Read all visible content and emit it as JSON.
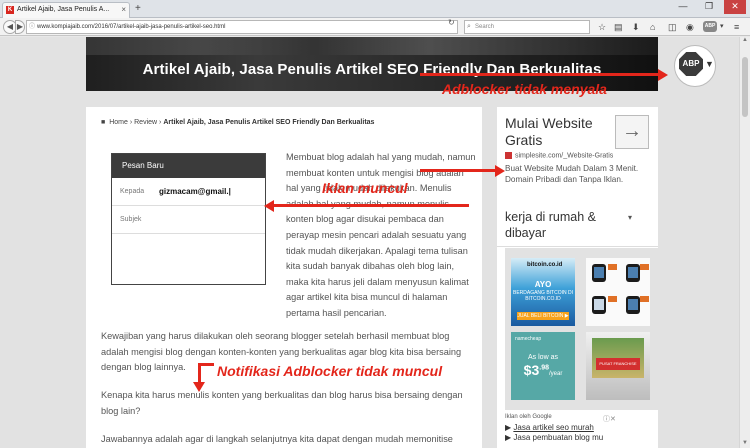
{
  "browser": {
    "tab_title": "Artikel Ajaib, Jasa Penulis A...",
    "tab_close": "×",
    "new_tab": "+",
    "back": "◀",
    "forward": "▶",
    "url": "www.kompiajaib.com/2016/07/artikel-ajaib-jasa-penulis-artikel-seo.html",
    "reload": "↻",
    "search_placeholder": "Search",
    "abp_small_label": "ABP",
    "window_min": "—",
    "window_max": "❐",
    "window_close": "✕"
  },
  "banner": {
    "title": "Artikel Ajaib, Jasa Penulis Artikel SEO Friendly Dan Berkualitas"
  },
  "abp_badge": {
    "label": "ABP"
  },
  "breadcrumb": {
    "home": "Home",
    "sep1": "›",
    "review": "Review",
    "sep2": "›",
    "current": "Artikel Ajaib, Jasa Penulis Artikel SEO Friendly Dan Berkualitas"
  },
  "form": {
    "header": "Pesan Baru",
    "to_label": "Kepada",
    "to_value": "gizmacam@gmail.|",
    "subject_label": "Subjek"
  },
  "article": {
    "para_side": "Membuat blog adalah hal yang mudah, namun membuat konten untuk mengisi blog adalah hal yang tidak mudah dilakukan. Menulis adalah hal yang mudah, namun menulis konten blog agar disukai pembaca dan perayap mesin pencari adalah sesuatu yang tidak mudah dikerjakan. Apalagi tema tulisan kita sudah banyak dibahas oleh blog lain, maka kita harus jeli dalam menyusun kalimat agar artikel kita bisa muncul di halaman pertama hasil pencarian.",
    "para2": "Kewajiban yang harus dilakukan oleh seorang blogger setelah berhasil membuat blog adalah mengisi blog dengan konten-konten yang berkualitas agar blog kita bisa bersaing dengan blog lainnya.",
    "para3": "Kenapa kita harus menulis konten yang berkualitas dan blog harus bisa bersaing dengan blog lain?",
    "para4": "Jawabannya adalah agar di langkah selanjutnya kita dapat dengan mudah memonitise"
  },
  "sidebar": {
    "ad_title": "Mulai Website Gratis",
    "ad_arrow": "→",
    "ad_url": "simplesite.com/_Website-Gratis",
    "ad_desc": "Buat Website Mudah Dalam 3 Menit. Domain Pribadi dan Tanpa Iklan.",
    "ad2_title": "kerja di rumah & dibayar",
    "ad2_caret": "▾",
    "bitcoin": {
      "logo": "bitcoin.co.id",
      "headline": "AYO",
      "text": "BERDAGANG BITCOIN DI BITCOIN.CO.ID",
      "button": "JUAL BELI BITCOIN ▶"
    },
    "namecheap": {
      "brand": "namecheap",
      "as_low_as": "As low as",
      "price_main": "$3",
      "price_cents": ".98",
      "price_unit": "/year"
    },
    "shop_sign": "PUSAT FRANCHISE",
    "ads_label": "Iklan oleh Google",
    "ads_info": "ⓘ✕",
    "links": [
      "Jasa artikel seo murah",
      "Jasa pembuatan blog mu"
    ]
  },
  "annotations": {
    "adblocker_off": "Adblocker tidak menyala",
    "ads_shown": "Iklan muncul",
    "notif_hidden": "Notifikasi Adblocker tidak muncul"
  },
  "colors": {
    "annotation": "#e3261b",
    "banner_bg": "#2a2a2a",
    "form_header": "#3b3b3b"
  }
}
